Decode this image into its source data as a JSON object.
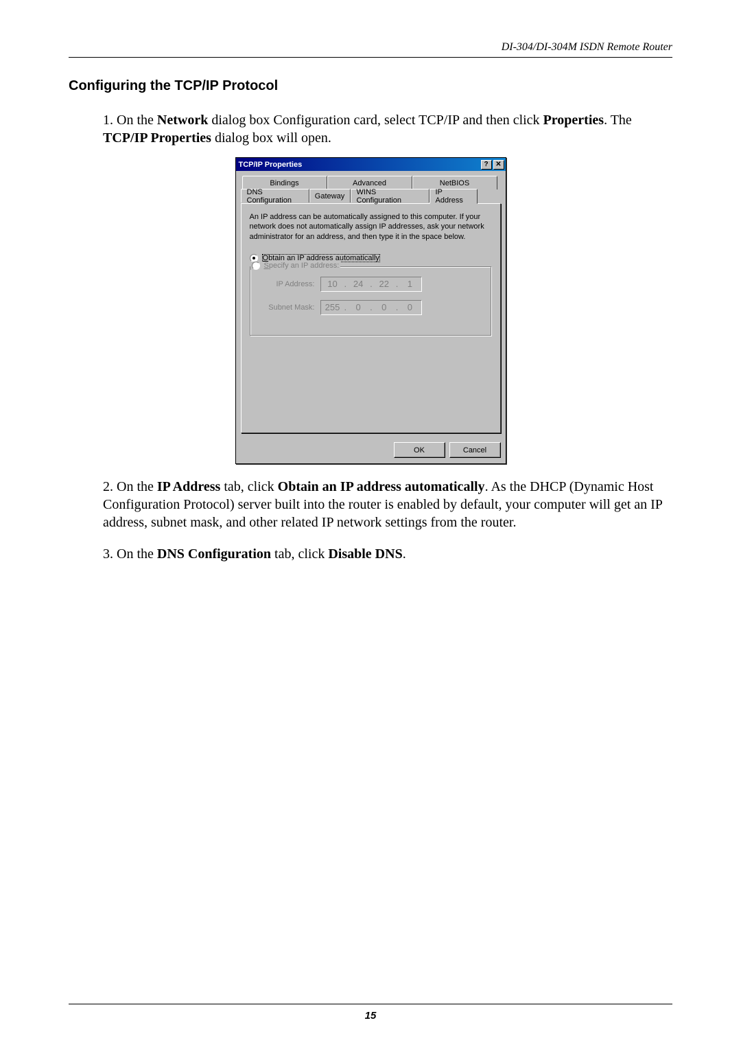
{
  "header": {
    "runningHeader": "DI-304/DI-304M ISDN Remote Router"
  },
  "section": {
    "heading": "Configuring the TCP/IP Protocol"
  },
  "para1": {
    "prefix": "1. On the ",
    "b1": "Network",
    "mid1": " dialog box Configuration card, select TCP/IP and then click ",
    "b2": "Properties",
    "mid2": ". The ",
    "b3": "TCP/IP Properties",
    "suffix": " dialog box will open."
  },
  "dialog": {
    "title": "TCP/IP Properties",
    "help": "?",
    "close": "✕",
    "tabsRow1": {
      "t1": "Bindings",
      "t2": "Advanced",
      "t3": "NetBIOS"
    },
    "tabsRow2": {
      "t1": "DNS Configuration",
      "t2": "Gateway",
      "t3": "WINS Configuration",
      "t4": "IP Address"
    },
    "description": "An IP address can be automatically assigned to this computer. If your network does not automatically assign IP addresses, ask your network administrator for an address, and then type it in the space below.",
    "radio1": {
      "accel": "O",
      "rest": "btain an IP address automatically"
    },
    "radio2": {
      "accel": "S",
      "rest": "pecify an IP address:"
    },
    "fields": {
      "ip": {
        "label": "IP Address:",
        "o1": "10",
        "o2": "24",
        "o3": "22",
        "o4": "1"
      },
      "mask": {
        "label": "Subnet Mask:",
        "o1": "255",
        "o2": "0",
        "o3": "0",
        "o4": "0"
      }
    },
    "buttons": {
      "ok": "OK",
      "cancel": "Cancel"
    }
  },
  "para2": {
    "p1": "2. On the ",
    "b1": "IP Address",
    "p2": " tab, click ",
    "b2": "Obtain an IP address automatically",
    "p3": ". As the DHCP (Dynamic Host Configuration Protocol) server built into the router is enabled by default, your computer will get an IP address, subnet mask, and other related IP network settings from the router."
  },
  "para3": {
    "p1": "3. On the ",
    "b1": "DNS Configuration",
    "p2": " tab, click ",
    "b2": "Disable DNS",
    "p3": "."
  },
  "footer": {
    "page": "15"
  }
}
